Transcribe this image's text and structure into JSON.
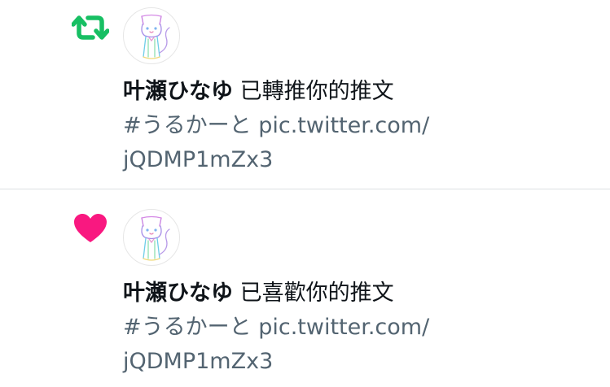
{
  "notifications": [
    {
      "type_icon": "retweet-icon",
      "icon_color": "#17bf63",
      "user_name": "叶瀬ひなゆ",
      "action": "已轉推你的推文",
      "tweet_line1": "#うるかーと pic.twitter.com/",
      "tweet_line2": "jQDMP1mZx3"
    },
    {
      "type_icon": "heart-icon",
      "icon_color": "#f91880",
      "user_name": "叶瀬ひなゆ",
      "action": "已喜歡你的推文",
      "tweet_line1": "#うるかーと pic.twitter.com/",
      "tweet_line2": "jQDMP1mZx3"
    }
  ]
}
